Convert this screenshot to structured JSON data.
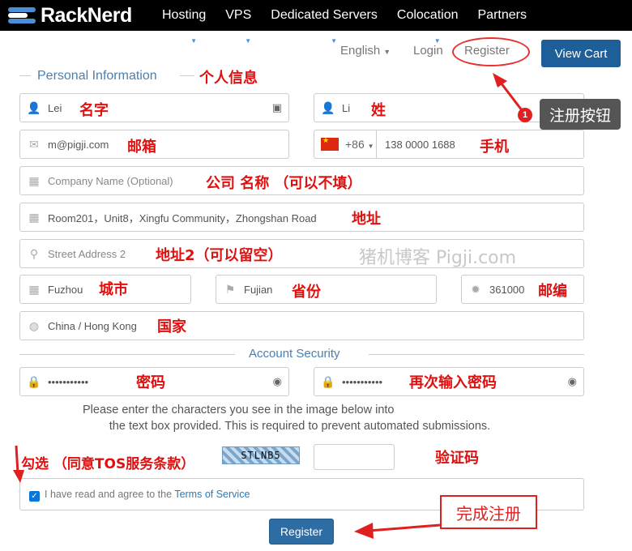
{
  "brand": {
    "name": "RackNerd"
  },
  "nav": [
    {
      "label": "Hosting"
    },
    {
      "label": "VPS"
    },
    {
      "label": "Dedicated Servers"
    },
    {
      "label": "Colocation"
    },
    {
      "label": "Partners"
    }
  ],
  "header": {
    "language": "English",
    "login": "Login",
    "register": "Register",
    "view_cart": "View Cart"
  },
  "sections": {
    "personal": "Personal Information",
    "security": "Account Security"
  },
  "fields": {
    "first_name": "Lei",
    "last_name": "Li",
    "email": "m@pigji.com",
    "phone_code": "+86",
    "phone": "138 0000 1688",
    "company_placeholder": "Company Name (Optional)",
    "address1": "Room201，Unit8，Xingfu Community，Zhongshan Road",
    "address2_placeholder": "Street Address 2",
    "city": "Fuzhou",
    "state": "Fujian",
    "postcode": "361000",
    "country": "China / Hong Kong",
    "password": "•••••••••••",
    "password_confirm": "•••••••••••"
  },
  "captcha": {
    "info_line1": "Please enter the characters you see in the image below into",
    "info_line2": "the text box provided. This is required to prevent automated submissions.",
    "code": "STLNB5"
  },
  "tos": {
    "text": "I have read and agree to the ",
    "link": "Terms of Service",
    "checked": true
  },
  "submit": "Register",
  "annotations": {
    "personal": "个人信息",
    "first_name": "名字",
    "last_name": "姓",
    "email": "邮箱",
    "phone": "手机",
    "company": "公司 名称 （可以不填）",
    "address1": "地址",
    "address2": "地址2（可以留空）",
    "city": "城市",
    "state": "省份",
    "postcode": "邮编",
    "country": "国家",
    "password": "密码",
    "password_confirm": "再次输入密码",
    "captcha": "验证码",
    "tos": "勾选 （同意TOS服务条款）",
    "register_tip": "注册按钮",
    "badge": "1",
    "complete": "完成注册",
    "watermark": "猪机博客 Pigji.com"
  },
  "colors": {
    "accent": "#1e5f99",
    "annotation": "#e01010"
  }
}
